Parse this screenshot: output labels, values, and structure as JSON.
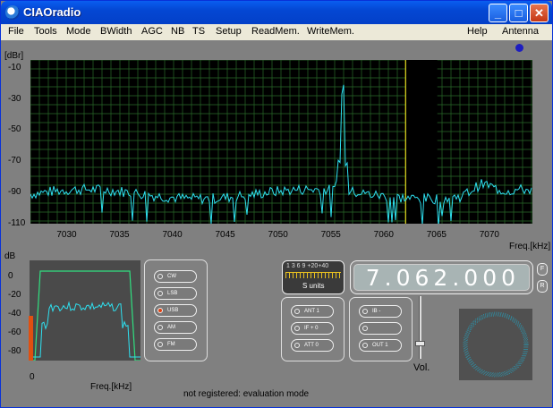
{
  "window": {
    "title": "CIAOradio"
  },
  "title_buttons": {
    "minimize": "_",
    "maximize": "□",
    "close": "✕"
  },
  "menu": [
    "File",
    "Tools",
    "Mode",
    "BWidth",
    "AGC",
    "NB",
    "TS",
    "Setup",
    "ReadMem.",
    "WriteMem."
  ],
  "menu_right": [
    "Help",
    "Antenna"
  ],
  "spectrum": {
    "ylabel": "[dBr]",
    "yticks": [
      "-10",
      "-30",
      "-50",
      "-70",
      "-90",
      "-110"
    ],
    "xticks": [
      "7030",
      "7035",
      "7040",
      "7045",
      "7050",
      "7055",
      "7060",
      "7065",
      "7070"
    ],
    "xlabel": "Freq.[kHz]",
    "ymin": -110,
    "ymax": -5,
    "xmin": 7026.5,
    "xmax": 7074,
    "marker_freq": 7062.0,
    "passband": [
      7062.0,
      7065.0
    ],
    "peak": {
      "freq": 7056.0,
      "level": -29
    }
  },
  "audio": {
    "ylabel": "dB",
    "yticks": [
      "0",
      "-20",
      "-40",
      "-60",
      "-80"
    ],
    "x0": "0",
    "xlabel": "Freq.[kHz]"
  },
  "modes": [
    {
      "label": "CW",
      "selected": false
    },
    {
      "label": "LSB",
      "selected": false
    },
    {
      "label": "USB",
      "selected": true
    },
    {
      "label": "AM",
      "selected": false
    },
    {
      "label": "FM",
      "selected": false
    }
  ],
  "smeter": {
    "scale": "1  3  6  9  +20+40",
    "unit": "S units"
  },
  "frequency": {
    "display": "7.062.000",
    "btn_f": "F",
    "btn_r": "R"
  },
  "panel_left": [
    "ANT 1",
    "IF + 0",
    "ATT 0"
  ],
  "panel_right": [
    "IB -",
    "",
    "OUT 1"
  ],
  "volume": {
    "label": "Vol."
  },
  "status": "not registered: evaluation mode",
  "colors": {
    "trace": "#2ee0f0",
    "grid": "#2a6a2a",
    "bg": "#000000",
    "passband": "#000000"
  }
}
